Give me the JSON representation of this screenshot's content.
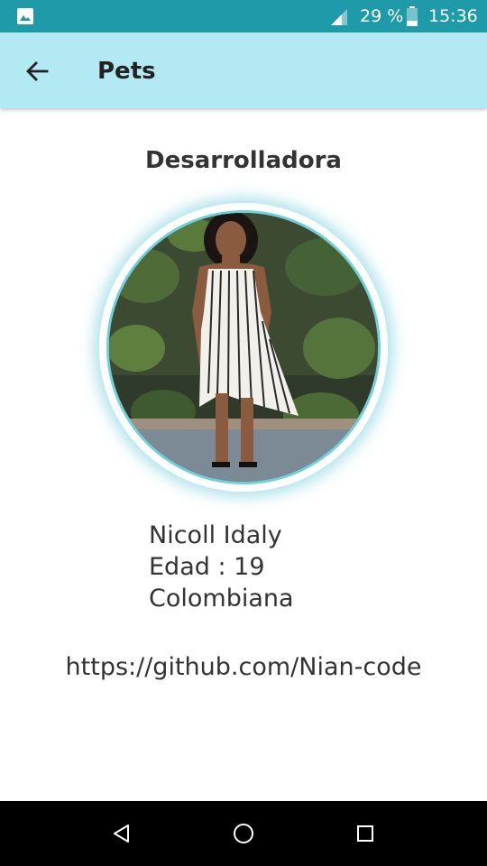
{
  "status_bar": {
    "battery_percent": "29 %",
    "time": "15:36",
    "icons": [
      "gallery-icon",
      "signal-icon",
      "battery-icon"
    ],
    "background_color": "#1f9aa8"
  },
  "app_bar": {
    "title": "Pets",
    "back_icon": "arrow-back-icon",
    "background_color": "#b3e9f3"
  },
  "profile": {
    "section_title": "Desarrolladora",
    "name": "Nicoll Idaly",
    "age": "Edad : 19",
    "nationality": "Colombiana",
    "link": "https://github.com/Nian-code",
    "ring_color": "#6fcfdd"
  },
  "nav_bar": {
    "buttons": [
      "back-triangle-icon",
      "home-circle-icon",
      "recents-square-icon"
    ]
  }
}
